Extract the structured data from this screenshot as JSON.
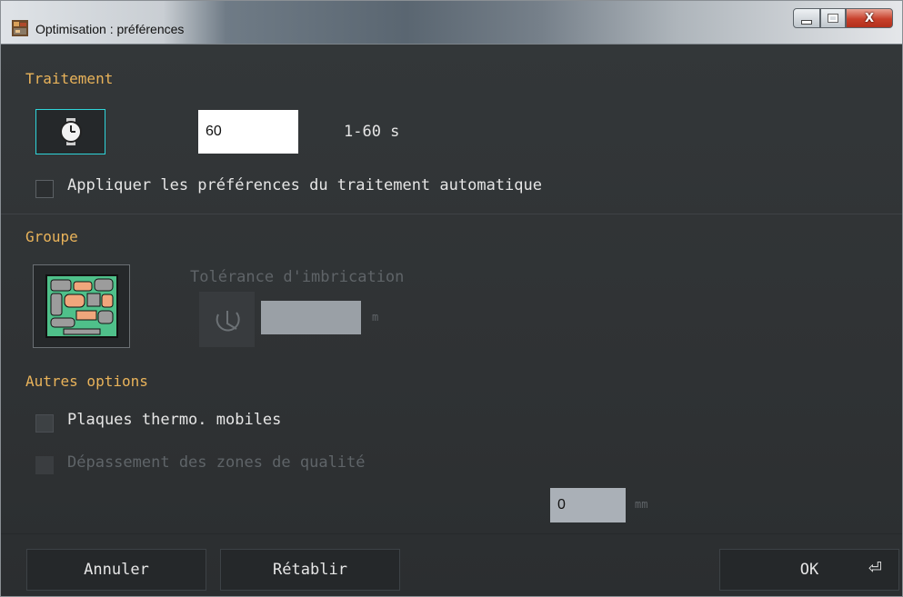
{
  "window": {
    "title": "Optimisation : préférences",
    "close_glyph": "X"
  },
  "traitement": {
    "section_title": "Traitement",
    "time_value": "60",
    "range_label": "1-60 s",
    "apply_auto_label": "Appliquer les préférences du traitement automatique",
    "icon": "stopwatch-icon"
  },
  "groupe": {
    "section_title": "Groupe",
    "tolerance_label": "Tolérance d'imbrication",
    "tolerance_value": "",
    "tolerance_unit": "m",
    "icon": "nesting-layout-icon"
  },
  "autres": {
    "section_title": "Autres options",
    "mobile_plates_label": "Plaques thermo. mobiles",
    "quality_zone_label": "Dépassement des zones de qualité",
    "quality_value": "0",
    "quality_unit": "mm"
  },
  "footer": {
    "cancel_label": "Annuler",
    "reset_label": "Rétablir",
    "ok_label": "OK",
    "ok_glyph": "⏎"
  },
  "colors": {
    "section_title": "#e9b35a",
    "background": "#2e3133",
    "button": "#25282a",
    "focus_border": "#2fd4d9"
  }
}
